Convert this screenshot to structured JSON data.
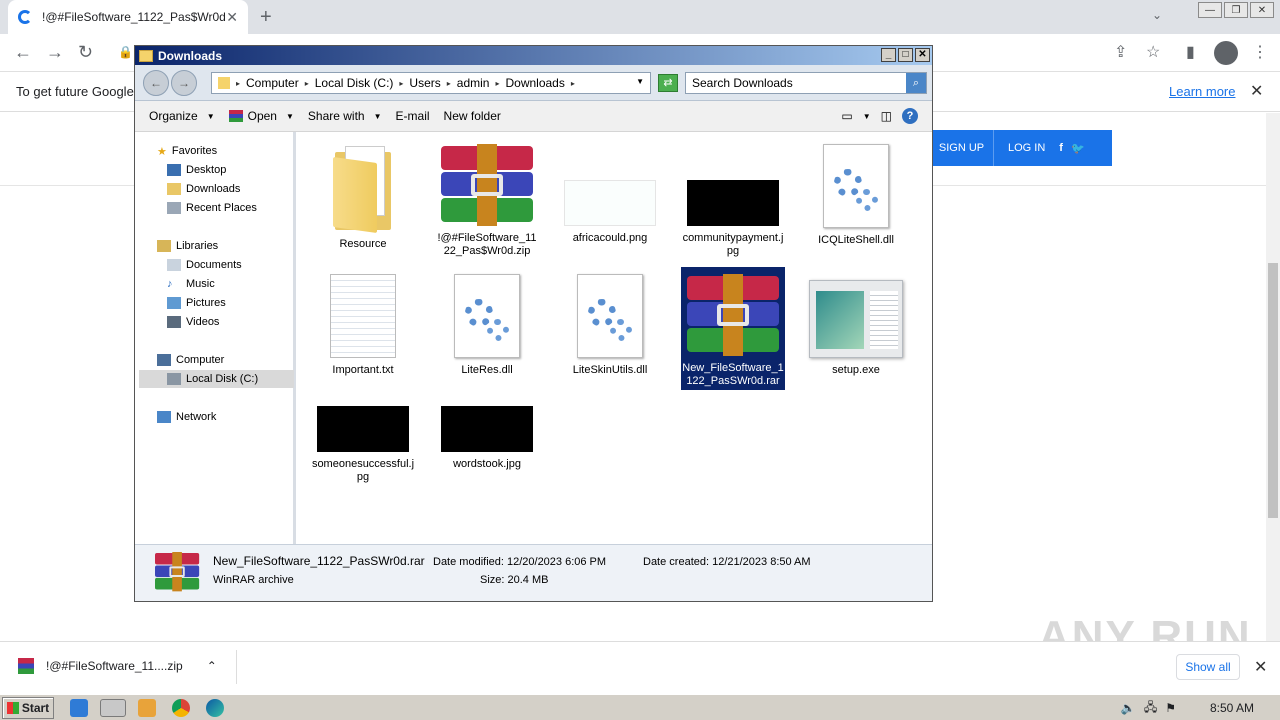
{
  "browser": {
    "tab_title": "!@#FileSoftware_1122_Pas$Wr0d",
    "infobar_message": "To get future Google",
    "learn_more": "Learn more",
    "sign_up": "SIGN UP",
    "log_in": "LOG IN"
  },
  "downloads_bar": {
    "item": "!@#FileSoftware_11....zip",
    "show_all": "Show all"
  },
  "watermark": "ANY RUN",
  "explorer": {
    "title": "Downloads",
    "breadcrumb": [
      "Computer",
      "Local Disk (C:)",
      "Users",
      "admin",
      "Downloads"
    ],
    "search_placeholder": "Search Downloads",
    "commands": {
      "organize": "Organize",
      "open": "Open",
      "share_with": "Share with",
      "email": "E-mail",
      "new_folder": "New folder"
    },
    "nav": {
      "favorites": "Favorites",
      "desktop": "Desktop",
      "downloads": "Downloads",
      "recent": "Recent Places",
      "libraries": "Libraries",
      "documents": "Documents",
      "music": "Music",
      "pictures": "Pictures",
      "videos": "Videos",
      "computer": "Computer",
      "local_disk": "Local Disk (C:)",
      "network": "Network"
    },
    "files": [
      {
        "name": "Resource",
        "kind": "folder"
      },
      {
        "name": "!@#FileSoftware_1122_Pas$Wr0d.zip",
        "kind": "rar-icon"
      },
      {
        "name": "africacould.png",
        "kind": "image"
      },
      {
        "name": "communitypayment.jpg",
        "kind": "image"
      },
      {
        "name": "ICQLiteShell.dll",
        "kind": "dll"
      },
      {
        "name": "Important.txt",
        "kind": "txt"
      },
      {
        "name": "LiteRes.dll",
        "kind": "dll"
      },
      {
        "name": "LiteSkinUtils.dll",
        "kind": "dll"
      },
      {
        "name": "New_FileSoftware_1122_PasSWr0d.rar",
        "kind": "rar-icon",
        "selected": true
      },
      {
        "name": "setup.exe",
        "kind": "exe"
      },
      {
        "name": "someonesuccessful.jpg",
        "kind": "image"
      },
      {
        "name": "wordstook.jpg",
        "kind": "image"
      }
    ],
    "details": {
      "name": "New_FileSoftware_1122_PasSWr0d.rar",
      "type": "WinRAR archive",
      "date_modified": "Date modified:  12/20/2023 6:06 PM",
      "size": "Size:  20.4 MB",
      "date_created": "Date created:  12/21/2023 8:50 AM"
    }
  },
  "taskbar": {
    "start": "Start",
    "time": "8:50 AM"
  },
  "colors": {
    "title_bar": "#0a246a",
    "chrome_accent": "#1a73e8",
    "selection": "#0a246a"
  }
}
